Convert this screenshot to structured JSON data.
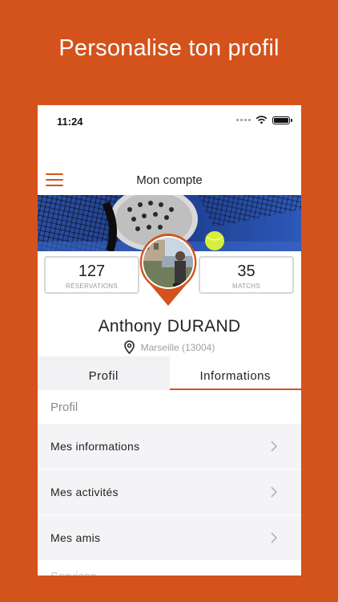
{
  "headline": "Personalise ton profil",
  "status_bar": {
    "time": "11:24"
  },
  "navbar": {
    "title": "Mon compte",
    "menu_icon": "hamburger-icon"
  },
  "stats": {
    "reservations": {
      "value": "127",
      "label": "RÉSERVATIONS"
    },
    "matchs": {
      "value": "35",
      "label": "MATCHS"
    }
  },
  "user": {
    "first_name": "Anthony",
    "last_name": "DURAND",
    "location": "Marseille (13004)"
  },
  "tabs": [
    {
      "label": "Profil",
      "active": false
    },
    {
      "label": "Informations",
      "active": true
    }
  ],
  "section": {
    "title": "Profil"
  },
  "menu_items": [
    {
      "label": "Mes informations"
    },
    {
      "label": "Mes activités"
    },
    {
      "label": "Mes amis"
    }
  ],
  "section2": {
    "title": "Services"
  },
  "colors": {
    "accent": "#d4521b",
    "list_bg": "#f4f4f6",
    "muted_text": "#9a9a9a"
  }
}
